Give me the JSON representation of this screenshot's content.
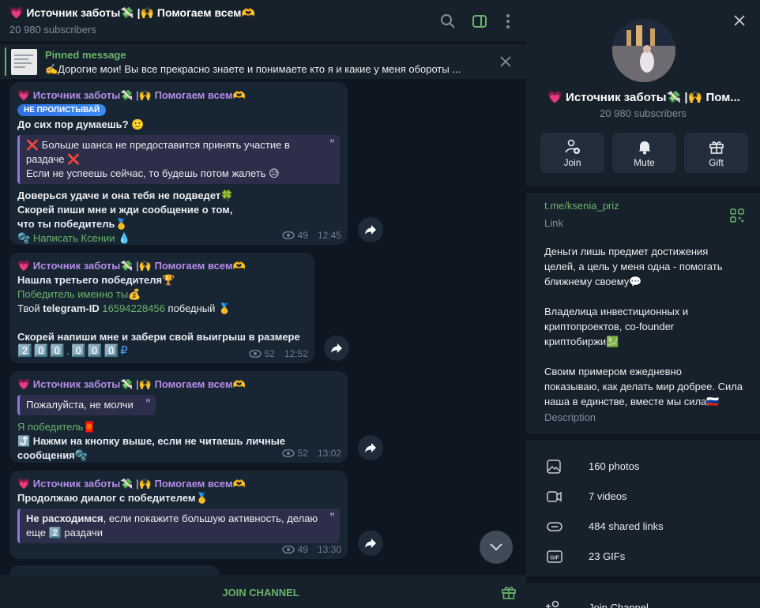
{
  "header": {
    "title": "💗 Источник заботы💸 |🙌 Помогаем всем🫶",
    "subscribers": "20 980 subscribers"
  },
  "pinned": {
    "label": "Pinned message",
    "text": "✍️Дорогие мои! Вы все прекрасно знаете и понимаете кто я и какие у меня обороты ..."
  },
  "messages": [
    {
      "author": "💗 Источник заботы💸 |🙌 Помогаем всем🫶",
      "badge": "НЕ ПРОЛИСТЫВАЙ",
      "line1": "До сих пор думаешь? 🙂",
      "quote1": "❌ Больше шанса не предоставится принять участие в",
      "quote2": "раздаче ❌",
      "quote3": "Если не успеешь сейчас, то будешь потом жалеть 😥",
      "line2": "Доверься удаче и она тебя не подведет🍀",
      "line3": "Скорей пиши мне и жди сообщение о том,",
      "line4": "что ты победитель🥇",
      "link_prefix": "🫧 ",
      "link": "Написать Ксении",
      "link_suffix": " 💧",
      "views": "49",
      "time": "12:45"
    },
    {
      "author": "💗 Источник заботы💸 |🙌 Помогаем всем🫶",
      "line1": "Нашла третьего победителя🏆",
      "link": "Победитель именно ты",
      "link_suffix": "💰",
      "line2_pre": "Твой ",
      "line2_bold": "telegram-ID",
      "line2_id": "16594228456",
      "line2_post": " победный 🥇",
      "line3": "Скорей напиши мне и забери свой выигрыш в размере",
      "prize": "2️⃣0️⃣0️⃣.0️⃣0️⃣0️⃣₽",
      "views": "52",
      "time": "12:52"
    },
    {
      "author": "💗 Источник заботы💸 |🙌 Помогаем всем🫶",
      "quote1": "Пожалуйста, не молчи",
      "link": "Я победитель",
      "link_suffix": "🧧",
      "line1": "⤴️ Нажми на кнопку выше, если не читаешь личные",
      "line2": "сообщения🫧",
      "views": "52",
      "time": "13:02"
    },
    {
      "author": "💗 Источник заботы💸 |🙌 Помогаем всем🫶",
      "line1": "Продолжаю диалог с победителем🥇",
      "quote1_bold": "Не расходимся",
      "quote1_rest": ", если покажите большую активность, делаю",
      "quote2": "еще 2️⃣ раздачи",
      "views": "49",
      "time": "13:30"
    }
  ],
  "footer": {
    "join_label": "JOIN CHANNEL"
  },
  "profile": {
    "name": "💗 Источник заботы💸 |🙌 Пом...",
    "subscribers": "20 980 subscribers",
    "buttons": [
      {
        "label": "Join"
      },
      {
        "label": "Mute"
      },
      {
        "label": "Gift"
      }
    ],
    "link": "t.me/ksenia_priz",
    "link_label": "Link",
    "desc": [
      "Деньги лишь предмет достижения",
      "целей, а цель у меня одна - помогать",
      "ближнему своему💬",
      "",
      "Владелица инвестиционных и",
      "криптопроектов, co-founder",
      "криптобиржи💹",
      "",
      "Своим примером ежедневно",
      "показываю, как делать мир добрее. Сила",
      "наша в единстве, вместе мы сила🇷🇺"
    ],
    "desc_label": "Description",
    "media": [
      {
        "label": "160 photos"
      },
      {
        "label": "7 videos"
      },
      {
        "label": "484 shared links"
      },
      {
        "label": "23 GIFs"
      }
    ],
    "join_channel": "Join Channel"
  },
  "colors": {
    "accent": "#6ab36c",
    "author": "#b68de8",
    "bubble": "#182533",
    "panel": "#17212b"
  }
}
